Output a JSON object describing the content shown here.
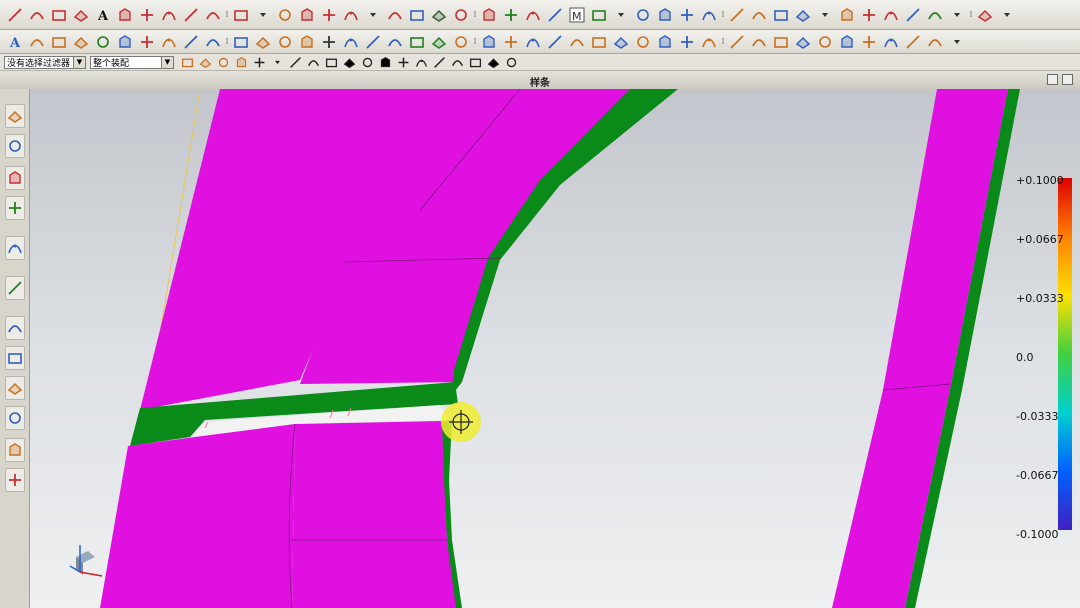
{
  "window": {
    "title": "样条"
  },
  "toolbar_row1": {
    "icons": [
      "line-icon",
      "arc-icon",
      "rectangle-icon",
      "point-icon",
      "text-icon",
      "polygon-icon",
      "plane-icon",
      "curve-icon",
      "offset-curve-icon",
      "surface-icon",
      "bridge-icon",
      "more-icon",
      "trim-icon",
      "extend-icon",
      "spline-icon",
      "helix-icon",
      "more-icon",
      "box-icon",
      "mesh-icon",
      "bar-icon",
      "split-icon",
      "point-set-icon",
      "axis-icon",
      "sweep-icon",
      "face-icon",
      "m-icon",
      "analysis-icon",
      "dropdown-icon",
      "brush-icon",
      "fillet-icon",
      "chamfer-icon",
      "shell-icon",
      "draft-icon",
      "thicken-icon",
      "rib-icon",
      "emboss-icon",
      "dropdown-icon",
      "sew-icon",
      "patch-icon",
      "extract-icon",
      "replace-icon",
      "wrap-icon",
      "dropdown-icon",
      "section-icon",
      "dropdown-icon"
    ],
    "colors": [
      "#c83030",
      "#c83030",
      "#c83030",
      "#c83030",
      "#111111",
      "#c83030",
      "#c83030",
      "#c83030",
      "#c83030",
      "#c83030",
      "#c83030",
      "#333333",
      "#c87020",
      "#c83030",
      "#c83030",
      "#c83030",
      "#333333",
      "#c83030",
      "#3060c0",
      "#306030",
      "#c83030",
      "#c83030",
      "#208020",
      "#c83030",
      "#3060c0",
      "#c83030",
      "#208020",
      "#333333",
      "#3060c0",
      "#3060c0",
      "#3060c0",
      "#3060c0",
      "#c87020",
      "#c87020",
      "#3060c0",
      "#3060c0",
      "#333333",
      "#c87020",
      "#c83030",
      "#c83030",
      "#3060c0",
      "#208020",
      "#333333",
      "#c83030",
      "#333333"
    ]
  },
  "toolbar_row2": {
    "icons": [
      "text-icon",
      "measure-icon",
      "cube-icon",
      "cube-solid-icon",
      "grid-icon",
      "table-icon",
      "block-icon",
      "frame-icon",
      "shelf-icon",
      "stack-icon",
      "layers-icon",
      "cylinder-icon",
      "cross-icon",
      "angle-icon",
      "x-axis-icon",
      "beam-icon",
      "panel-icon",
      "camera-icon",
      "doc-icon",
      "copy-icon",
      "upload-icon",
      "save-icon",
      "folder-icon",
      "clamp-icon",
      "gauge-icon",
      "pipe-icon",
      "bracket-icon",
      "marker-icon",
      "angle-bracket-icon",
      "square-icon",
      "square-icon",
      "tube-icon",
      "corner-icon",
      "wedge-icon",
      "pair-icon",
      "hatch-icon",
      "hash-icon",
      "arch-icon",
      "panel-icon",
      "stack-icon",
      "column-icon",
      "link-icon",
      "dropdown-icon"
    ],
    "colors": [
      "#3060c0",
      "#c87020",
      "#c87020",
      "#c87020",
      "#208020",
      "#3060c0",
      "#c83030",
      "#c87020",
      "#3060c0",
      "#3060c0",
      "#3060c0",
      "#c87020",
      "#c87020",
      "#c87020",
      "#333333",
      "#3060c0",
      "#3060c0",
      "#3060c0",
      "#208020",
      "#208020",
      "#c87020",
      "#3060c0",
      "#c87020",
      "#3060c0",
      "#3060c0",
      "#c87020",
      "#c87020",
      "#3060c0",
      "#c87020",
      "#3060c0",
      "#3060c0",
      "#c87020",
      "#c87020",
      "#c87020",
      "#c87020",
      "#3060c0",
      "#c87020",
      "#3060c0",
      "#c87020",
      "#3060c0",
      "#c87020",
      "#c87020",
      "#333333"
    ]
  },
  "filter_bar": {
    "selection_filter": "没有选择过滤器",
    "assembly_scope": "整个装配",
    "snap_icons": [
      "snap-filter-icon",
      "snap-point-icon",
      "snap-curve-icon",
      "snap-face-icon",
      "select-box-icon",
      "dropdown-icon",
      "view-icon",
      "cube-view-icon",
      "endpoint-snap-icon",
      "midpoint-snap-icon",
      "line-snap-icon",
      "line-snap-icon",
      "arc-snap-icon",
      "center-snap-icon",
      "quadrant-snap-icon",
      "intersection-snap-icon",
      "slash-snap-icon",
      "node-snap-icon",
      "clip-icon"
    ]
  },
  "sidebar": {
    "icons": [
      "assembly-navigator-icon",
      "constraint-navigator-icon",
      "part-navigator-icon",
      "reuse-library-icon",
      "hd3d-icon",
      "web-browser-icon",
      "history-icon",
      "system-materials-icon",
      "process-studio-icon",
      "manikin-icon",
      "roles-icon",
      "report-icon"
    ],
    "colors": [
      "#c87020",
      "#3060c0",
      "#c83030",
      "#208020",
      "#3060c0",
      "#208020",
      "#3060c0",
      "#3060c0",
      "#c87020",
      "#3060c0",
      "#c87020",
      "#c83030"
    ]
  },
  "color_scale": {
    "labels": [
      "+0.1000",
      "+0.0667",
      "+0.0333",
      "0.0",
      "-0.0333",
      "-0.0667",
      "-0.1000"
    ],
    "colors": [
      "#e00000",
      "#ff8000",
      "#ffe000",
      "#40d040",
      "#00d0d0",
      "#0060ff",
      "#4020c0"
    ]
  },
  "model": {
    "surface_color": "#e011e0",
    "edge_color": "#0a8a18"
  }
}
